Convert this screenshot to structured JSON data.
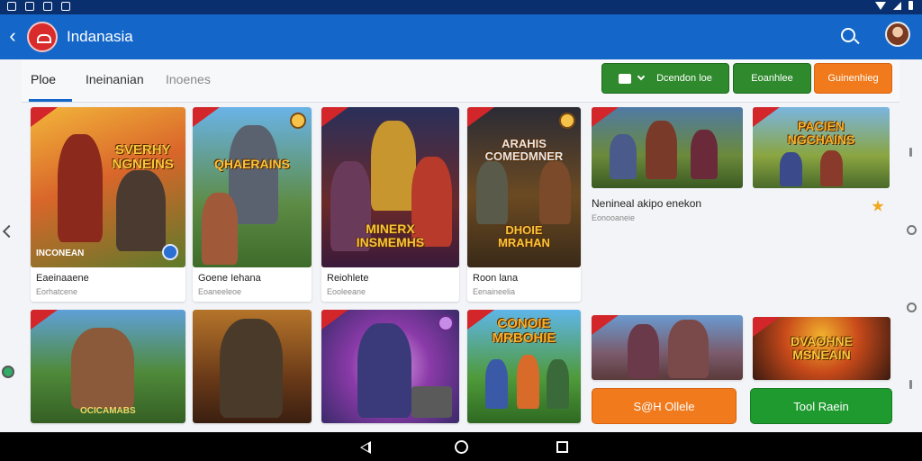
{
  "app": {
    "title": "Indanasia"
  },
  "tabs": [
    {
      "label": "Ploe"
    },
    {
      "label": "Ineinanian"
    },
    {
      "label": "Inoenes"
    }
  ],
  "actions": {
    "dropdown_label": "Dcendon loe",
    "button2_label": "Eoanhlee",
    "button3_label": "Guinenhieg"
  },
  "games": [
    {
      "art_title": "SVERHY\nNGNEINS",
      "art_label": "INCONEAN",
      "name": "Eaeinaaene",
      "sub": "Eorhatcene"
    },
    {
      "art_title": "QHAERAINS",
      "art_label": "",
      "name": "Goene Iehana",
      "sub": "Eoaneeleoe"
    },
    {
      "art_title": "MINERX\nINSMEMHS",
      "art_label": "",
      "name": "Reiohlete",
      "sub": "Eooleeane"
    },
    {
      "art_title": "ARAHIS\nCOMEDMNER",
      "art_title2": "DHOIE\nMRAHAN",
      "art_label": "",
      "name": "Roon lana",
      "sub": "Eenaineelia"
    },
    {
      "art_title": "",
      "art_label": "",
      "name": "Nenineal akipo enekon",
      "sub": "Eonooaneie"
    },
    {
      "art_title": "PACIEN\nNGCHAINS",
      "art_label": "",
      "name": "",
      "sub": ""
    },
    {
      "art_title": "",
      "art_label": "OCICAMABS",
      "name": "",
      "sub": ""
    },
    {
      "art_title": "",
      "art_label": "",
      "name": "",
      "sub": ""
    },
    {
      "art_title": "",
      "art_label": "",
      "name": "",
      "sub": ""
    },
    {
      "art_title": "CONOIE\nMRBOHIE",
      "art_label": "",
      "name": "",
      "sub": ""
    },
    {
      "art_title": "",
      "art_label": "",
      "name": "",
      "sub": ""
    },
    {
      "art_title": "DVAOHNE\nMSNEAIN",
      "art_label": "",
      "name": "",
      "sub": ""
    }
  ],
  "cta": {
    "left": "S@H Ollele",
    "right": "Tool Raein"
  },
  "colors": {
    "appbar": "#1467c8",
    "status": "#0a2f6e",
    "green": "#2f8a2d",
    "orange": "#f07a1c",
    "green_cta": "#1e9a2e"
  },
  "icons": [
    "back-arrow-icon",
    "app-logo-icon",
    "search-icon",
    "avatar",
    "chat-icon",
    "chevron-down-icon",
    "star-icon",
    "nav-back-icon",
    "nav-home-icon",
    "nav-recents-icon"
  ]
}
